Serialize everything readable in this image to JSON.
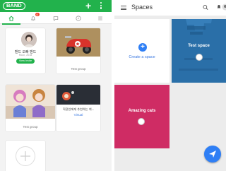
{
  "band": {
    "logo": "BAND",
    "plus": "+",
    "tabs": [
      {
        "icon": "home-icon",
        "active": true
      },
      {
        "icon": "bell-icon",
        "badge": "6"
      },
      {
        "icon": "chat-bubble-icon"
      },
      {
        "icon": "compass-icon"
      },
      {
        "icon": "menu-icon"
      }
    ],
    "profile_card": {
      "name": "밴드 오빠 밴드",
      "subtitle": "Roon, 2018",
      "invite_label": "View Invite"
    },
    "cards": [
      {
        "caption": "Test group"
      },
      {
        "caption": "Test group"
      },
      {
        "caption": "Virtual",
        "title": "직장인에게 추천하는 취..."
      }
    ]
  },
  "spaces": {
    "title": "Spaces",
    "create_label": "Create a space",
    "cards": [
      {
        "label": "Test space",
        "color": "#2a6fa8"
      },
      {
        "label": "Amazing cats",
        "color": "#d8306a"
      }
    ]
  },
  "colors": {
    "band_green": "#22b24c",
    "spaces_blue": "#2f7ff5"
  }
}
